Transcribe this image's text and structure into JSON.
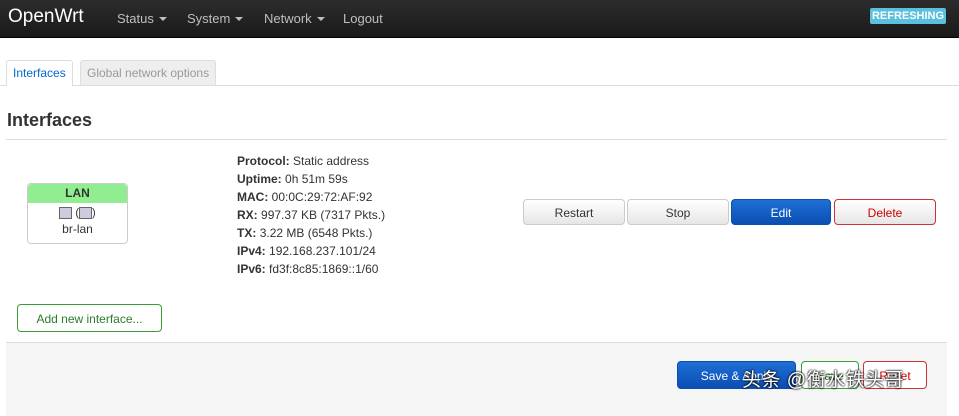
{
  "navbar": {
    "brand": "OpenWrt",
    "menus": [
      {
        "label": "Status",
        "dropdown": true
      },
      {
        "label": "System",
        "dropdown": true
      },
      {
        "label": "Network",
        "dropdown": true
      },
      {
        "label": "Logout",
        "dropdown": false
      }
    ],
    "refresh_badge": "REFRESHING"
  },
  "tabs": {
    "active": "Interfaces",
    "inactive": "Global network options"
  },
  "section_title": "Interfaces",
  "interface": {
    "name": "LAN",
    "device": "br-lan",
    "status_rows": [
      {
        "label": "Protocol:",
        "value": "Static address"
      },
      {
        "label": "Uptime:",
        "value": "0h 51m 59s"
      },
      {
        "label": "MAC:",
        "value": "00:0C:29:72:AF:92"
      },
      {
        "label": "RX:",
        "value": "997.37 KB (7317 Pkts.)"
      },
      {
        "label": "TX:",
        "value": "3.22 MB (6548 Pkts.)"
      },
      {
        "label": "IPv4:",
        "value": "192.168.237.101/24"
      },
      {
        "label": "IPv6:",
        "value": "fd3f:8c85:1869::1/60"
      }
    ],
    "buttons": {
      "restart": "Restart",
      "stop": "Stop",
      "edit": "Edit",
      "delete": "Delete"
    }
  },
  "add_interface_label": "Add new interface...",
  "footer": {
    "save_apply": "Save & Apply",
    "save": "Save",
    "reset": "Reset"
  },
  "watermark": "头条 @衡水铁头哥",
  "colors": {
    "navbar_bg": "#222222",
    "refresh_badge": "#5bc0de",
    "interface_header": "#90ee90",
    "primary": "#0b4eb2",
    "positive": "#3a9d3a",
    "negative": "#cc3333"
  }
}
